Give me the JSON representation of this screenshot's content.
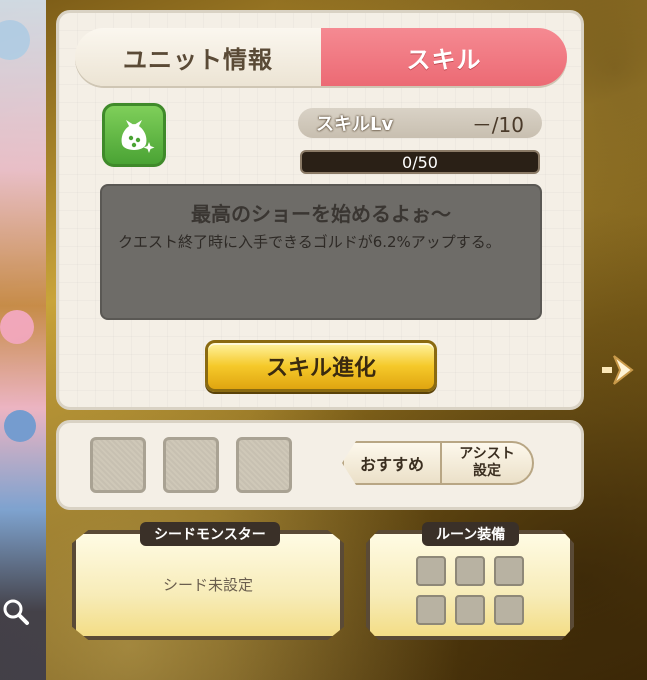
{
  "tabs": {
    "unit_info": "ユニット情報",
    "skill": "スキル"
  },
  "skill": {
    "icon": "money-bag-sparkle-icon",
    "level_label": "スキルLv",
    "level_value": "－/10",
    "exp_text": "0/50",
    "title": "最高のショーを始めるよぉ～",
    "description": "クエスト終了時に入手できるゴルドが6.2%アップする。",
    "evolve_label": "スキル進化"
  },
  "assist": {
    "recommend_label": "おすすめ",
    "assist_line1": "アシスト",
    "assist_line2": "設定"
  },
  "seed": {
    "title": "シードモンスター",
    "status": "シード未設定"
  },
  "rune": {
    "title": "ルーン装備"
  },
  "colors": {
    "active_tab": "#ec6a74",
    "button_gold": "#f5c92a",
    "panel_bg": "#f4efe6"
  }
}
